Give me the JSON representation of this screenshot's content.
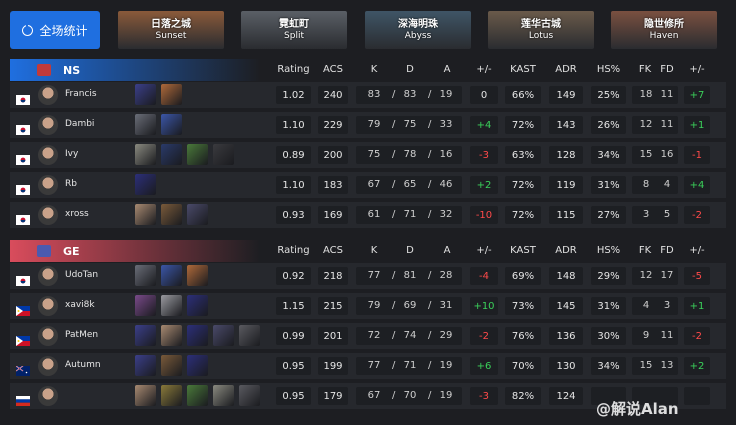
{
  "topbar": {
    "overall_label": "全场统计",
    "maps": [
      {
        "cn": "日落之城",
        "en": "Sunset",
        "color": "#8a5a3a"
      },
      {
        "cn": "霓虹町",
        "en": "Split",
        "color": "#5a5f66"
      },
      {
        "cn": "深海明珠",
        "en": "Abyss",
        "color": "#3f5566"
      },
      {
        "cn": "莲华古城",
        "en": "Lotus",
        "color": "#6a5a4a"
      },
      {
        "cn": "隐世修所",
        "en": "Haven",
        "color": "#7a5040"
      }
    ]
  },
  "headers": [
    "Rating",
    "ACS",
    "K",
    "D",
    "A",
    "+/-",
    "KAST",
    "ADR",
    "HS%",
    "FK",
    "FD",
    "+/-"
  ],
  "teams": [
    {
      "name": "NS",
      "bar_color": "#1f6fe0",
      "logo_color": "#c23a3a",
      "players": [
        {
          "name": "Francis",
          "flag": "kr",
          "agents": [
            "#3b3f8a",
            "#b06a3a"
          ],
          "rating": "1.02",
          "acs": "240",
          "k": "83",
          "d": "83",
          "a": "19",
          "pm": "0",
          "kast": "66%",
          "adr": "149",
          "hs": "25%",
          "fk": "18",
          "fd": "11",
          "fpm": "+7"
        },
        {
          "name": "Dambi",
          "flag": "kr",
          "agents": [
            "#6a6e78",
            "#3b56a8"
          ],
          "rating": "1.10",
          "acs": "229",
          "k": "79",
          "d": "75",
          "a": "33",
          "pm": "+4",
          "kast": "72%",
          "adr": "143",
          "hs": "26%",
          "fk": "12",
          "fd": "11",
          "fpm": "+1"
        },
        {
          "name": "Ivy",
          "flag": "kr",
          "agents": [
            "#8a8a80",
            "#2a3a6a",
            "#4a7a3a",
            "#3a3a3e"
          ],
          "rating": "0.89",
          "acs": "200",
          "k": "75",
          "d": "78",
          "a": "16",
          "pm": "-3",
          "kast": "63%",
          "adr": "128",
          "hs": "34%",
          "fk": "15",
          "fd": "16",
          "fpm": "-1"
        },
        {
          "name": "Rb",
          "flag": "kr",
          "agents": [
            "#2c2f7a"
          ],
          "rating": "1.10",
          "acs": "183",
          "k": "67",
          "d": "65",
          "a": "46",
          "pm": "+2",
          "kast": "72%",
          "adr": "119",
          "hs": "31%",
          "fk": "8",
          "fd": "4",
          "fpm": "+4"
        },
        {
          "name": "xross",
          "flag": "kr",
          "agents": [
            "#a88a72",
            "#7a5a3a",
            "#4a4a6a"
          ],
          "rating": "0.93",
          "acs": "169",
          "k": "61",
          "d": "71",
          "a": "32",
          "pm": "-10",
          "kast": "72%",
          "adr": "115",
          "hs": "27%",
          "fk": "3",
          "fd": "5",
          "fpm": "-2"
        }
      ]
    },
    {
      "name": "GE",
      "bar_color": "#d94c5c",
      "logo_color": "#4a5ab0",
      "players": [
        {
          "name": "UdoTan",
          "flag": "kr",
          "agents": [
            "#6a6e78",
            "#3b56a8",
            "#b06a3a"
          ],
          "rating": "0.92",
          "acs": "218",
          "k": "77",
          "d": "81",
          "a": "28",
          "pm": "-4",
          "kast": "69%",
          "adr": "148",
          "hs": "29%",
          "fk": "12",
          "fd": "17",
          "fpm": "-5"
        },
        {
          "name": "xavi8k",
          "flag": "ph",
          "agents": [
            "#7a4a8a",
            "#9a9aa0",
            "#2c2f7a"
          ],
          "rating": "1.15",
          "acs": "215",
          "k": "79",
          "d": "69",
          "a": "31",
          "pm": "+10",
          "kast": "73%",
          "adr": "145",
          "hs": "31%",
          "fk": "4",
          "fd": "3",
          "fpm": "+1"
        },
        {
          "name": "PatMen",
          "flag": "ph",
          "agents": [
            "#3b3f8a",
            "#a88a72",
            "#2c2f7a",
            "#4a4a6a",
            "#5a5a60"
          ],
          "rating": "0.99",
          "acs": "201",
          "k": "72",
          "d": "74",
          "a": "29",
          "pm": "-2",
          "kast": "76%",
          "adr": "136",
          "hs": "30%",
          "fk": "9",
          "fd": "11",
          "fpm": "-2"
        },
        {
          "name": "Autumn",
          "flag": "au",
          "agents": [
            "#3b3f8a",
            "#7a5a3a",
            "#2c2f7a"
          ],
          "rating": "0.95",
          "acs": "199",
          "k": "77",
          "d": "71",
          "a": "19",
          "pm": "+6",
          "kast": "70%",
          "adr": "130",
          "hs": "34%",
          "fk": "15",
          "fd": "13",
          "fpm": "+2"
        },
        {
          "name": "",
          "flag": "ru",
          "agents": [
            "#a88a72",
            "#8a7a3a",
            "#4a7a3a",
            "#8a8a80",
            "#5a5a60"
          ],
          "rating": "0.95",
          "acs": "179",
          "k": "67",
          "d": "70",
          "a": "19",
          "pm": "-3",
          "kast": "82%",
          "adr": "124",
          "hs": "",
          "fk": "",
          "fd": "",
          "fpm": ""
        }
      ]
    }
  ],
  "watermark": "@解说Alan"
}
